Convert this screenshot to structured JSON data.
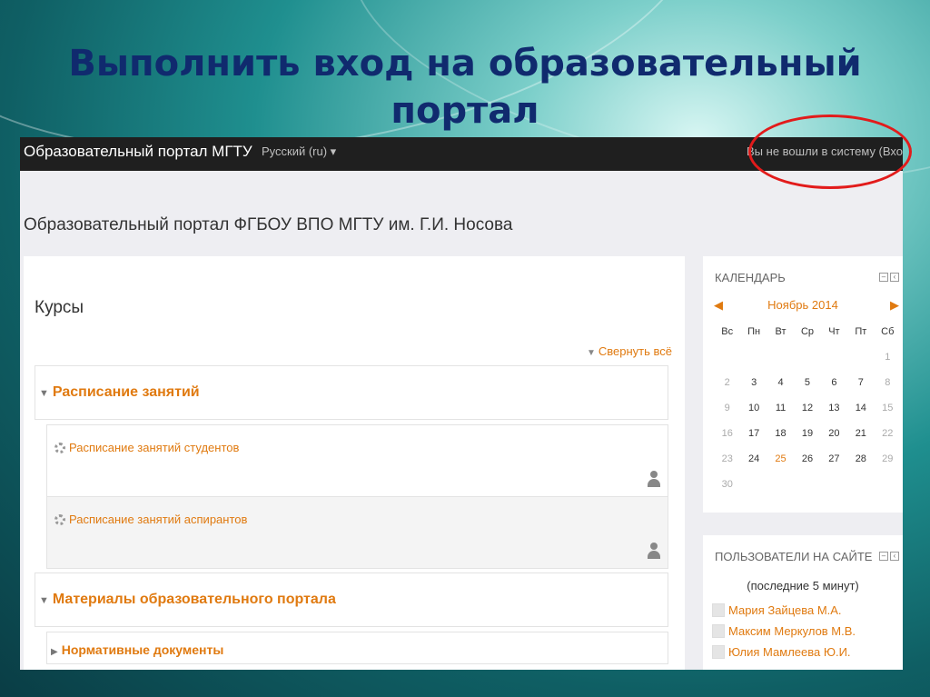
{
  "slide": {
    "title": "Выполнить вход на образовательный портал"
  },
  "navbar": {
    "brand": "Образовательный портал МГТУ",
    "language": "Русский (ru) ▾",
    "login_status": "Вы не вошли в систему (Вхо"
  },
  "header": {
    "title": "Образовательный портал ФГБОУ ВПО МГТУ им. Г.И. Носова"
  },
  "courses": {
    "heading": "Курсы",
    "collapse_all": "Свернуть всё",
    "category_schedule": "Расписание занятий",
    "course_students": "Расписание занятий студентов",
    "course_postgrads": "Расписание занятий аспирантов",
    "category_materials": "Материалы образовательного портала",
    "subcategory_regulatory": "Нормативные документы"
  },
  "calendar": {
    "heading": "КАЛЕНДАРЬ",
    "month": "Ноябрь 2014",
    "weekdays": [
      "Вс",
      "Пн",
      "Вт",
      "Ср",
      "Чт",
      "Пт",
      "Сб"
    ],
    "weeks": [
      [
        "",
        "",
        "",
        "",
        "",
        "",
        "1"
      ],
      [
        "2",
        "3",
        "4",
        "5",
        "6",
        "7",
        "8"
      ],
      [
        "9",
        "10",
        "11",
        "12",
        "13",
        "14",
        "15"
      ],
      [
        "16",
        "17",
        "18",
        "19",
        "20",
        "21",
        "22"
      ],
      [
        "23",
        "24",
        "25",
        "26",
        "27",
        "28",
        "29"
      ],
      [
        "30",
        "",
        "",
        "",
        "",
        "",
        ""
      ]
    ],
    "highlighted_day": "25"
  },
  "online_users": {
    "heading": "ПОЛЬЗОВАТЕЛИ НА САЙТЕ",
    "subtitle": "(последние 5 минут)",
    "users": [
      "Мария Зайцева М.А.",
      "Максим Меркулов М.В.",
      "Юлия Мамлеева Ю.И."
    ]
  },
  "colors": {
    "accent": "#e07a10",
    "navbar": "#1f1f1f",
    "slide_title": "#102a6e",
    "highlight_ellipse": "#e21b1b"
  }
}
